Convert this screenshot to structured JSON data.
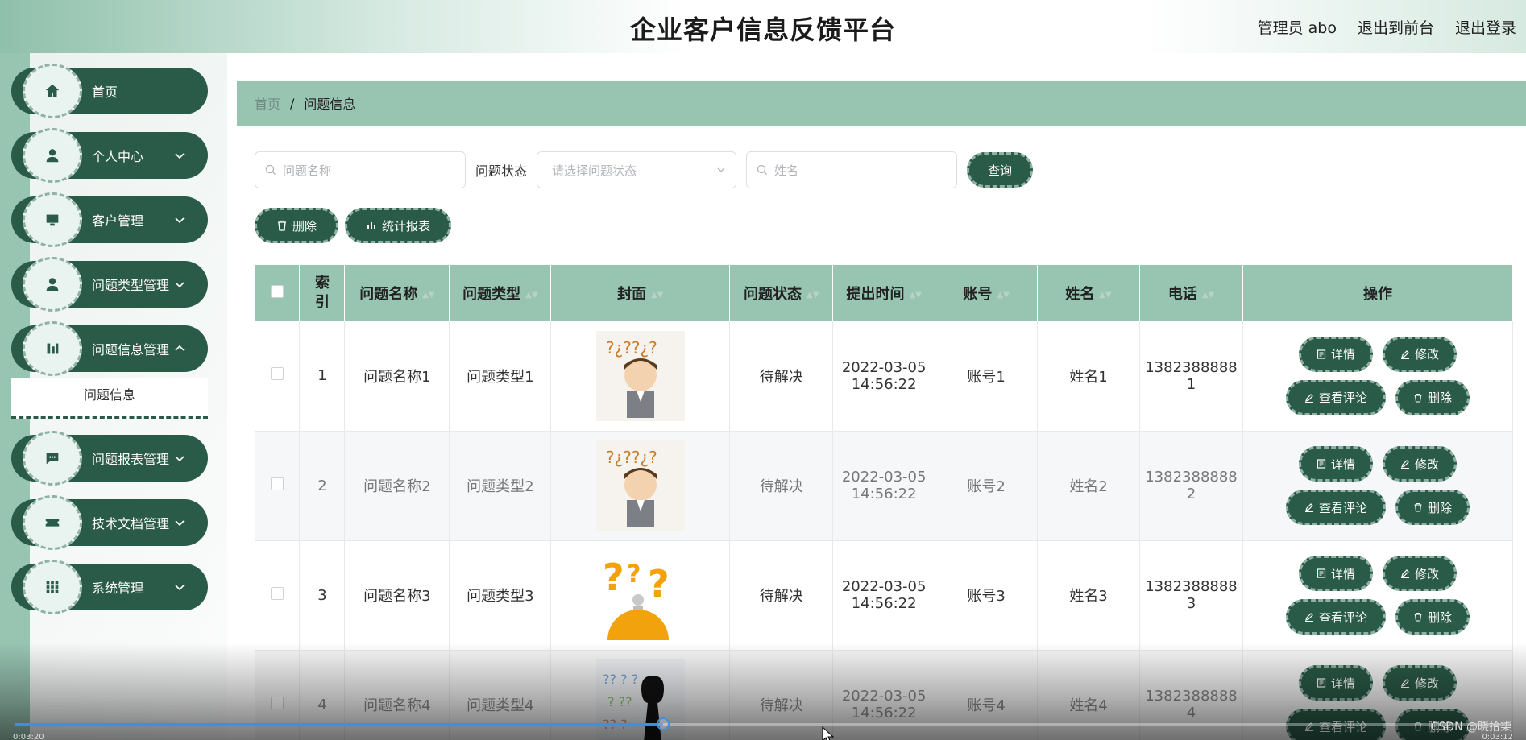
{
  "header": {
    "title": "企业客户信息反馈平台",
    "links": [
      "管理员 abo",
      "退出到前台",
      "退出登录"
    ]
  },
  "sidebar": {
    "items": [
      {
        "label": "首页",
        "icon": "home-icon",
        "expandable": false
      },
      {
        "label": "个人中心",
        "icon": "user-icon",
        "expandable": true
      },
      {
        "label": "客户管理",
        "icon": "monitor-icon",
        "expandable": true
      },
      {
        "label": "问题类型管理",
        "icon": "user-icon",
        "expandable": true
      },
      {
        "label": "问题信息管理",
        "icon": "chart-bar-icon",
        "expandable": true,
        "open": true,
        "children": [
          "问题信息"
        ]
      },
      {
        "label": "问题报表管理",
        "icon": "message-icon",
        "expandable": true
      },
      {
        "label": "技术文档管理",
        "icon": "ticket-icon",
        "expandable": true
      },
      {
        "label": "系统管理",
        "icon": "grid-icon",
        "expandable": true
      }
    ]
  },
  "breadcrumb": {
    "home": "首页",
    "separator": "/",
    "current": "问题信息"
  },
  "search": {
    "name_placeholder": "问题名称",
    "status_label": "问题状态",
    "status_placeholder": "请选择问题状态",
    "username_placeholder": "姓名",
    "query_label": "查询"
  },
  "toolbar": {
    "delete_label": "删除",
    "report_label": "统计报表"
  },
  "table": {
    "columns": [
      "索引",
      "问题名称",
      "问题类型",
      "封面",
      "问题状态",
      "提出时间",
      "账号",
      "姓名",
      "电话",
      "操作"
    ],
    "rows": [
      {
        "index": "1",
        "name": "问题名称1",
        "type": "问题类型1",
        "status": "待解决",
        "date": "2022-03-05",
        "time": "14:56:22",
        "account": "账号1",
        "person": "姓名1",
        "phone_a": "1382388888",
        "phone_b": "1"
      },
      {
        "index": "2",
        "name": "问题名称2",
        "type": "问题类型2",
        "status": "待解决",
        "date": "2022-03-05",
        "time": "14:56:22",
        "account": "账号2",
        "person": "姓名2",
        "phone_a": "1382388888",
        "phone_b": "2"
      },
      {
        "index": "3",
        "name": "问题名称3",
        "type": "问题类型3",
        "status": "待解决",
        "date": "2022-03-05",
        "time": "14:56:22",
        "account": "账号3",
        "person": "姓名3",
        "phone_a": "1382388888",
        "phone_b": "3"
      },
      {
        "index": "4",
        "name": "问题名称4",
        "type": "问题类型4",
        "status": "待解决",
        "date": "2022-03-05",
        "time": "14:56:22",
        "account": "账号4",
        "person": "姓名4",
        "phone_a": "1382388888",
        "phone_b": "4"
      }
    ],
    "actions": {
      "detail": "详情",
      "edit": "修改",
      "comments": "查看评论",
      "delete": "删除"
    }
  },
  "video": {
    "current_time": "0:03:20",
    "total_time": "0:03:12",
    "progress": 0.433,
    "watermark": "CSDN @晓拾柒"
  },
  "colors": {
    "primary": "#2a5a48",
    "accent": "#98c4b2",
    "progress": "#3d8fe0"
  }
}
